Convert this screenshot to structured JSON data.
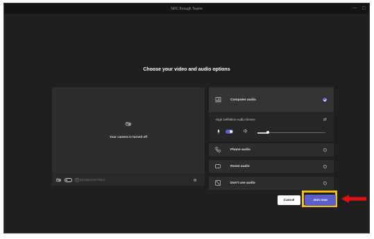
{
  "window": {
    "title": "NRC through Teams",
    "controls": {
      "minimize": "—",
      "maximize": "▢"
    }
  },
  "heading": "Choose your video and audio options",
  "video": {
    "camera_status": "Your camera is turned off",
    "camera_toggle": "off",
    "background_filters_label": "Background filters"
  },
  "audio": {
    "options": [
      {
        "label": "Computer audio",
        "icon": "laptop-audio-icon",
        "selected": true
      },
      {
        "label": "Phone audio",
        "icon": "phone-icon",
        "selected": false
      },
      {
        "label": "Room audio",
        "icon": "room-audio-icon",
        "selected": false
      },
      {
        "label": "Don't use audio",
        "icon": "no-audio-icon",
        "selected": false
      }
    ],
    "device_name": "High Definition Audio Device",
    "mic_toggle": "on",
    "volume_level": 0.15
  },
  "buttons": {
    "cancel": "Cancel",
    "join": "Join now"
  },
  "colors": {
    "accent": "#5b5fc7",
    "highlight": "#f6c200",
    "arrow": "#e01010",
    "background": "#1f1f1f",
    "panel": "#2d2d2d"
  }
}
